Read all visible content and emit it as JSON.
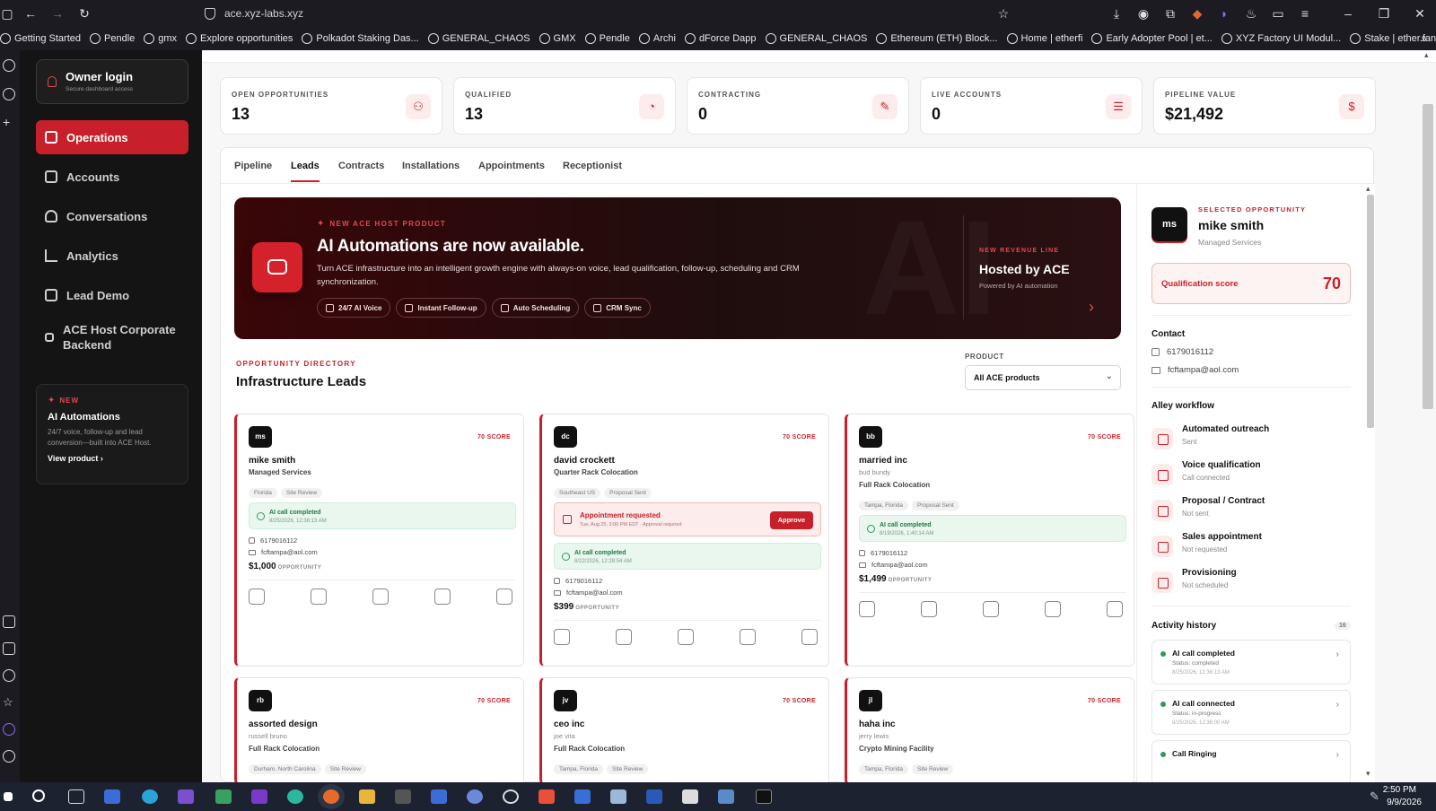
{
  "browser": {
    "url": "ace.xyz-labs.xyz",
    "bookmarks": [
      "Getting Started",
      "Pendle",
      "gmx",
      "Explore opportunities",
      "Polkadot Staking Das...",
      "GENERAL_CHAOS",
      "GMX",
      "Pendle",
      "Archi",
      "dForce Dapp",
      "GENERAL_CHAOS",
      "Ethereum (ETH) Block...",
      "Home | etherfi",
      "Early Adopter Pool | et...",
      "XYZ Factory UI Modul...",
      "Stake | ether.fan"
    ]
  },
  "sidebar": {
    "owner_title": "Owner login",
    "owner_sub": "Secure dashboard access",
    "items": [
      {
        "label": "Operations"
      },
      {
        "label": "Accounts"
      },
      {
        "label": "Conversations"
      },
      {
        "label": "Analytics"
      },
      {
        "label": "Lead Demo"
      },
      {
        "label": "ACE Host Corporate Backend"
      }
    ],
    "promo": {
      "badge": "NEW",
      "title": "AI Automations",
      "text": "24/7 voice, follow-up and lead conversion—built into ACE Host.",
      "link": "View product"
    }
  },
  "stats": [
    {
      "label": "OPEN OPPORTUNITIES",
      "value": "13"
    },
    {
      "label": "QUALIFIED",
      "value": "13"
    },
    {
      "label": "CONTRACTING",
      "value": "0"
    },
    {
      "label": "LIVE ACCOUNTS",
      "value": "0"
    },
    {
      "label": "PIPELINE VALUE",
      "value": "$21,492"
    }
  ],
  "tabs": [
    "Pipeline",
    "Leads",
    "Contracts",
    "Installations",
    "Appointments",
    "Receptionist"
  ],
  "hero": {
    "eyebrow": "NEW ACE HOST PRODUCT",
    "title": "AI Automations are now available.",
    "body": "Turn ACE infrastructure into an intelligent growth engine with always-on voice, lead qualification, follow-up, scheduling and CRM synchronization.",
    "chips": [
      "24/7 AI Voice",
      "Instant Follow-up",
      "Auto Scheduling",
      "CRM Sync"
    ],
    "right_eyebrow": "NEW REVENUE LINE",
    "right_title": "Hosted by ACE",
    "right_sub": "Powered by AI automation",
    "watermark": "AI"
  },
  "directory": {
    "eyebrow": "OPPORTUNITY DIRECTORY",
    "title": "Infrastructure Leads",
    "product_label": "PRODUCT",
    "product_value": "All ACE products"
  },
  "cards": [
    {
      "initials": "ms",
      "score": "70 SCORE",
      "name": "mike smith",
      "person": "",
      "product": "Managed Services",
      "tags": [
        "Florida",
        "Site Review"
      ],
      "appt": null,
      "ai_title": "AI call completed",
      "ai_time": "8/25/2026, 12:36:13 AM",
      "phone": "6179016112",
      "email": "fcftampa@aol.com",
      "amount": "$1,000",
      "amount_label": "OPPORTUNITY"
    },
    {
      "initials": "dc",
      "score": "70 SCORE",
      "name": "david crockett",
      "person": "",
      "product": "Quarter Rack Colocation",
      "tags": [
        "Southeast US",
        "Proposal Sent"
      ],
      "appt": {
        "title": "Appointment requested",
        "sub": "Tue, Aug 25, 3:00 PM EDT · Approval required",
        "button": "Approve"
      },
      "ai_title": "AI call completed",
      "ai_time": "8/22/2026, 12:28:54 AM",
      "phone": "6179016112",
      "email": "fcftampa@aol.com",
      "amount": "$399",
      "amount_label": "OPPORTUNITY"
    },
    {
      "initials": "bb",
      "score": "70 SCORE",
      "name": "married inc",
      "person": "bud bundy",
      "product": "Full Rack Colocation",
      "tags": [
        "Tampa, Florida",
        "Proposal Sent"
      ],
      "appt": null,
      "ai_title": "AI call completed",
      "ai_time": "8/19/2026, 1:40:14 AM",
      "phone": "6179016112",
      "email": "fcftampa@aol.com",
      "amount": "$1,499",
      "amount_label": "OPPORTUNITY"
    },
    {
      "initials": "rb",
      "score": "70 SCORE",
      "name": "assorted design",
      "person": "russell bruno",
      "product": "Full Rack Colocation",
      "tags": [
        "Durham, North Carolina",
        "Site Review"
      ]
    },
    {
      "initials": "jv",
      "score": "70 SCORE",
      "name": "ceo inc",
      "person": "joe vita",
      "product": "Full Rack Colocation",
      "tags": [
        "Tampa, Florida",
        "Site Review"
      ]
    },
    {
      "initials": "jl",
      "score": "70 SCORE",
      "name": "haha inc",
      "person": "jerry lewis",
      "product": "Crypto Mining Facility",
      "tags": [
        "Tampa, Florida",
        "Site Review"
      ]
    }
  ],
  "detail": {
    "eyebrow": "SELECTED OPPORTUNITY",
    "initials": "ms",
    "name": "mike smith",
    "product": "Managed Services",
    "score_label": "Qualification score",
    "score_value": "70",
    "contact_title": "Contact",
    "phone": "6179016112",
    "email": "fcftampa@aol.com",
    "workflow_title": "Alley workflow",
    "workflow": [
      {
        "title": "Automated outreach",
        "status": "Sent"
      },
      {
        "title": "Voice qualification",
        "status": "Call connected"
      },
      {
        "title": "Proposal / Contract",
        "status": "Not sent"
      },
      {
        "title": "Sales appointment",
        "status": "Not requested"
      },
      {
        "title": "Provisioning",
        "status": "Not scheduled"
      }
    ],
    "history_title": "Activity history",
    "history_count": "16",
    "history": [
      {
        "title": "AI call completed",
        "status": "Status: completed",
        "time": "8/25/2026, 12:36:13 AM"
      },
      {
        "title": "AI call connected",
        "status": "Status: in-progress",
        "time": "8/25/2026, 12:36:00 AM"
      },
      {
        "title": "Call Ringing",
        "status": "",
        "time": ""
      }
    ]
  },
  "taskbar": {
    "time": "2:50 PM",
    "date": "9/9/2026"
  },
  "colors": {
    "accent": "#c8202a",
    "sidebar": "#141414",
    "success": "#2e9a5a"
  }
}
